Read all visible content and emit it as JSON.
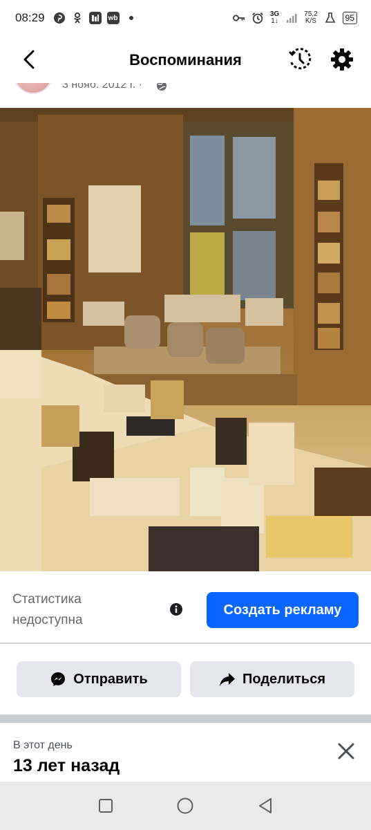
{
  "status_bar": {
    "time": "08:29",
    "left_icons": [
      "pinterest-icon",
      "odnoklassniki-icon",
      "app-square-icon",
      "wb-icon"
    ],
    "wb_label": "wb",
    "network_type_top": "3G",
    "network_type_bottom": "1↓",
    "speed_top": "75,2",
    "speed_bottom": "K/S",
    "battery": "95"
  },
  "header": {
    "title": "Воспоминания",
    "back_icon": "back-arrow-icon",
    "history_icon": "history-clock-icon",
    "settings_icon": "gear-icon"
  },
  "post": {
    "date": "3 нояб. 2012 г. ·",
    "privacy_icon": "globe-icon"
  },
  "photo": {
    "alt": "photo"
  },
  "stats": {
    "line1": "Статистика",
    "line2": "недоступна",
    "info_icon": "info-icon",
    "ad_button": "Создать рекламу"
  },
  "actions": {
    "send_label": "Отправить",
    "share_label": "Поделиться"
  },
  "memory": {
    "subtitle": "В этот день",
    "title": "13 лет назад"
  },
  "colors": {
    "accent": "#0866ff",
    "button_gray": "#e4e6eb",
    "secondary_text": "#65676b"
  }
}
